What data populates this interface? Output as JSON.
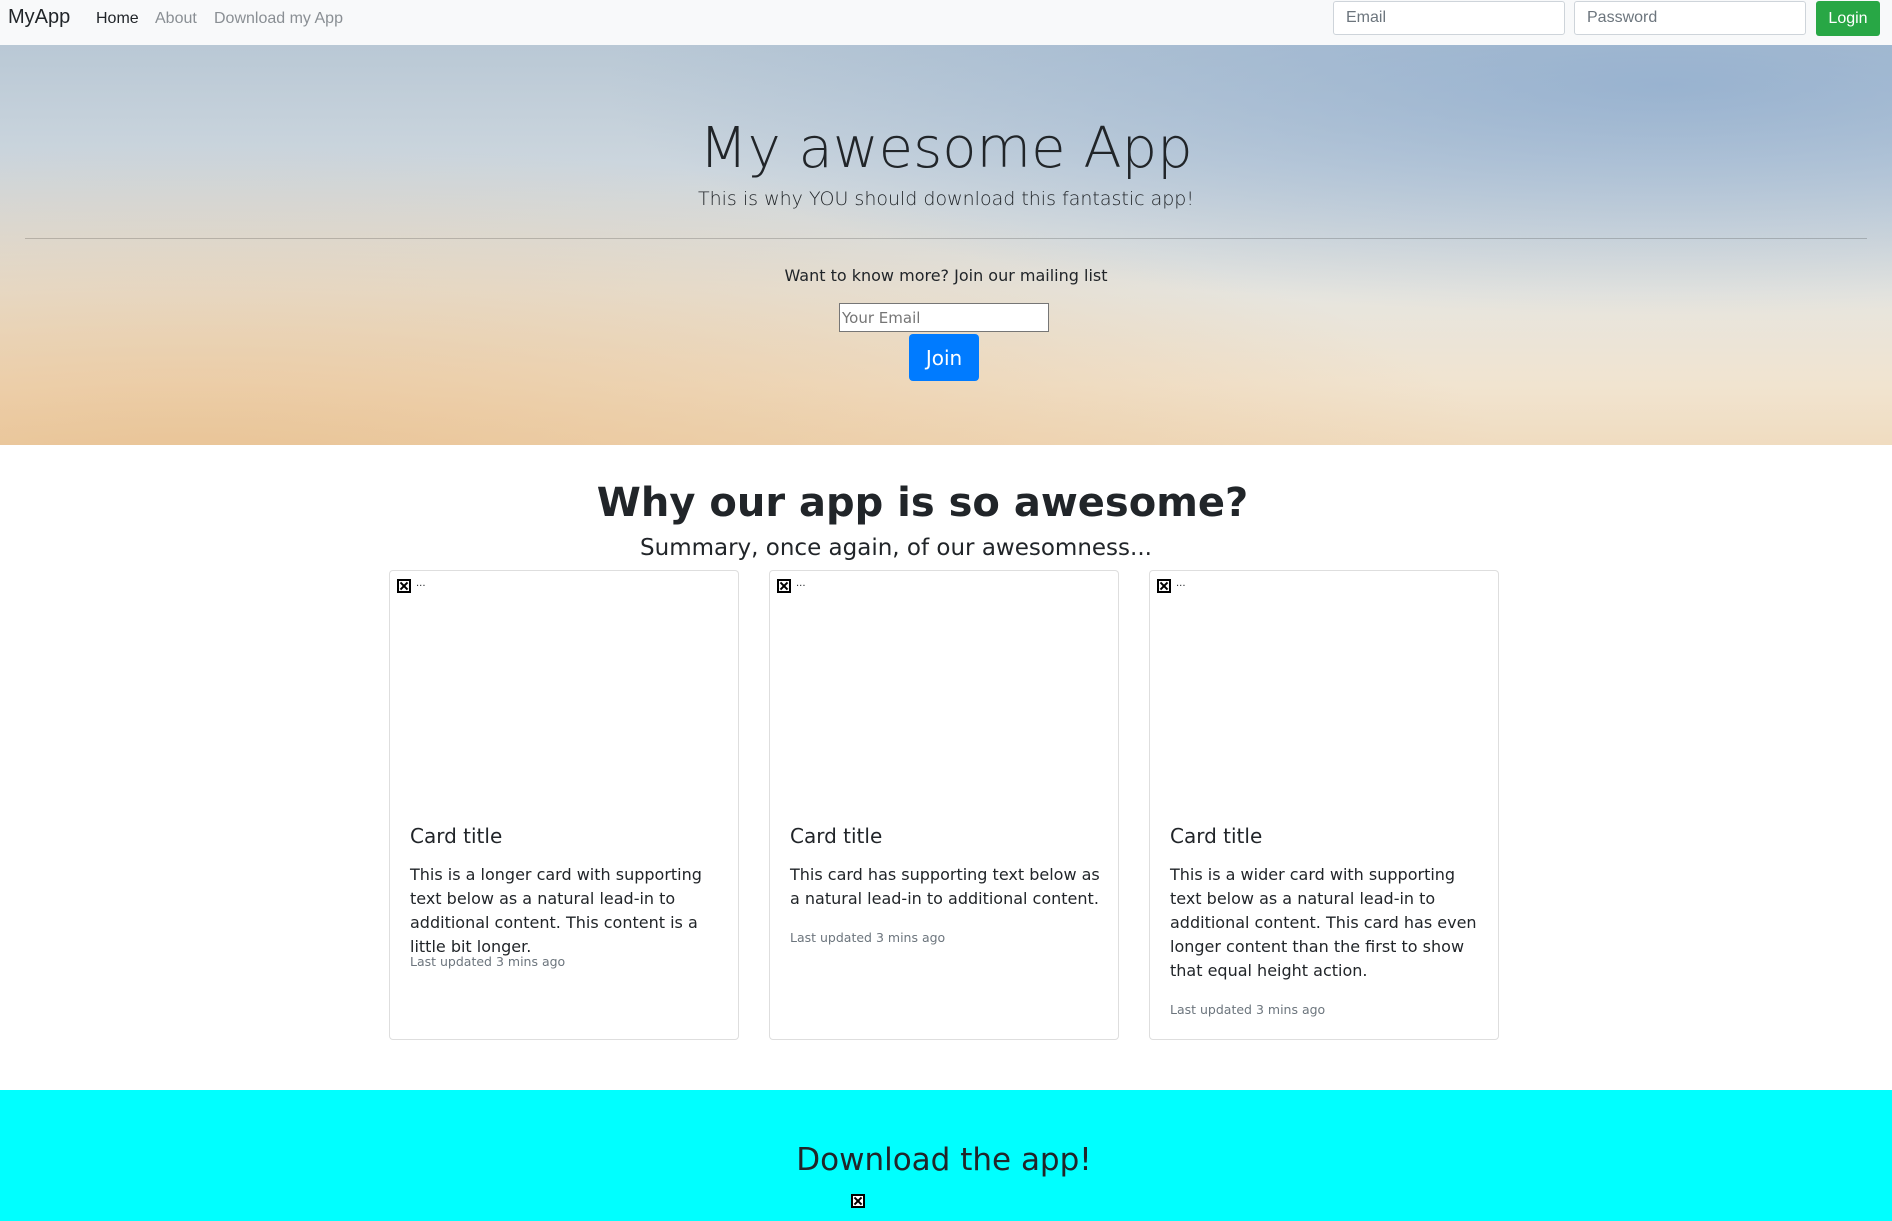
{
  "navbar": {
    "brand": "MyApp",
    "links": [
      "Home",
      "About",
      "Download my App"
    ],
    "email_placeholder": "Email",
    "password_placeholder": "Password",
    "login_label": "Login"
  },
  "hero": {
    "title": "My awesome App",
    "subtitle": "This is why YOU should download this fantastic app!",
    "mailing_text": "Want to know more? Join our mailing list",
    "email_placeholder": "Your Email",
    "join_label": "Join"
  },
  "features": {
    "title": "Why our app is so awesome?",
    "subtitle": "Summary, once again, of our awesomness...",
    "cards": [
      {
        "img_alt": "...",
        "title": "Card title",
        "text": "This is a longer card with supporting text below as a natural lead-in to additional content. This content is a little bit longer.",
        "meta": "Last updated 3 mins ago"
      },
      {
        "img_alt": "...",
        "title": "Card title",
        "text": "This card has supporting text below as a natural lead-in to additional content.",
        "meta": "Last updated 3 mins ago"
      },
      {
        "img_alt": "...",
        "title": "Card title",
        "text": "This is a wider card with supporting text below as a natural lead-in to additional content. This card has even longer content than the first to show that equal height action.",
        "meta": "Last updated 3 mins ago"
      }
    ]
  },
  "download": {
    "title": "Download the app!"
  },
  "colors": {
    "login": "#28a745",
    "join": "#007bff",
    "download_bg": "#00ffff",
    "navbar_bg": "#f8f9fa"
  }
}
